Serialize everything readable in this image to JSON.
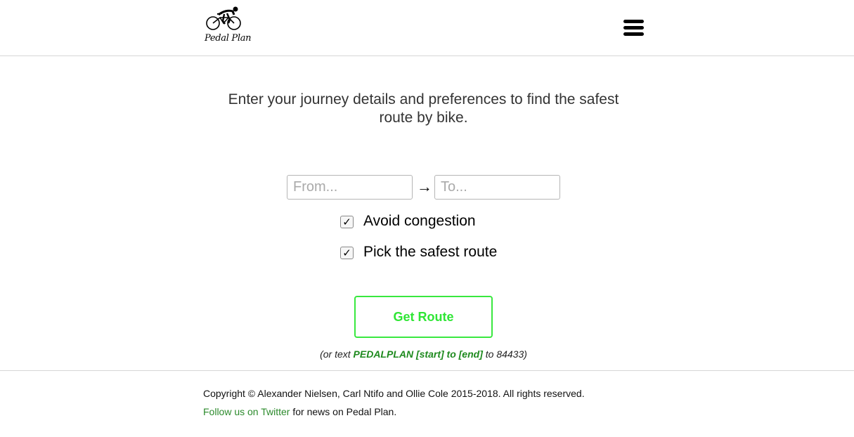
{
  "header": {
    "logo_text": "Pedal Plan",
    "logo_icon": "cyclist-icon",
    "menu_icon": "hamburger-menu-icon"
  },
  "intro": {
    "text": "Enter your journey details and preferences to find the safest route by bike."
  },
  "route": {
    "from_placeholder": "From...",
    "from_value": "",
    "to_placeholder": "To...",
    "to_value": "",
    "arrow": "→"
  },
  "options": [
    {
      "label": "Avoid congestion",
      "checked": true
    },
    {
      "label": "Pick the safest route",
      "checked": true
    }
  ],
  "checkmark": "✓",
  "get_route_label": "Get Route",
  "sms_note": {
    "prefix": "(or text ",
    "code": "PEDALPLAN [start] to [end]",
    "suffix": " to 84433)"
  },
  "footer": {
    "copyright": "Copyright © Alexander Nielsen, Carl Ntifo and Ollie Cole 2015-2018. All rights reserved.",
    "twitter_link": "Follow us on Twitter",
    "twitter_suffix": " for news on Pedal Plan."
  },
  "colors": {
    "accent_green": "#39e83f",
    "link_green": "#2b8a2b",
    "border_gray": "#d6d6d6"
  }
}
